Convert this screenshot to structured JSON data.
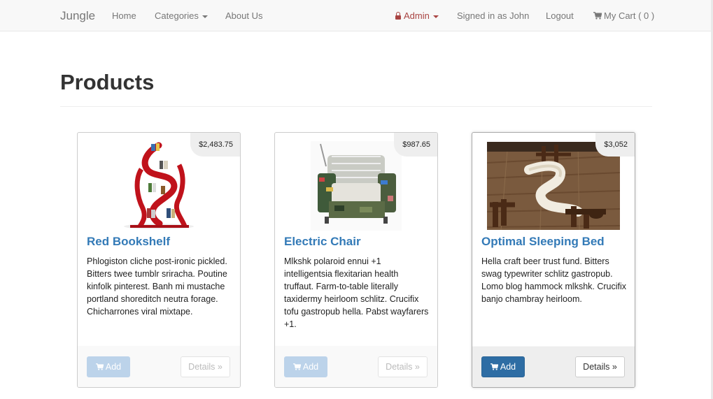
{
  "navbar": {
    "brand": "Jungle",
    "home": "Home",
    "categories": "Categories",
    "about": "About Us",
    "admin": "Admin",
    "signed_in": "Signed in as John",
    "logout": "Logout",
    "cart": "My Cart ( 0 )"
  },
  "page": {
    "title": "Products"
  },
  "products": [
    {
      "name": "Red Bookshelf",
      "price": "$2,483.75",
      "description": "Phlogiston cliche post-ironic pickled. Bitters twee tumblr sriracha. Poutine kinfolk pinterest. Banh mi mustache portland shoreditch neutra forage. Chicharrones viral mixtape.",
      "add_label": "Add",
      "details_label": "Details »"
    },
    {
      "name": "Electric Chair",
      "price": "$987.65",
      "description": "Mlkshk polaroid ennui +1 intelligentsia flexitarian health truffaut. Farm-to-table literally taxidermy heirloom schlitz. Crucifix tofu gastropub hella. Pabst wayfarers +1.",
      "add_label": "Add",
      "details_label": "Details »"
    },
    {
      "name": "Optimal Sleeping Bed",
      "price": "$3,052",
      "description": "Hella craft beer trust fund. Bitters swag typewriter schlitz gastropub. Lomo blog hammock mlkshk. Crucifix banjo chambray heirloom.",
      "add_label": "Add",
      "details_label": "Details »"
    }
  ],
  "colors": {
    "link": "#337ab7",
    "admin": "#a94442",
    "primary": "#2e6da4",
    "navbar_bg": "#f8f8f8"
  }
}
